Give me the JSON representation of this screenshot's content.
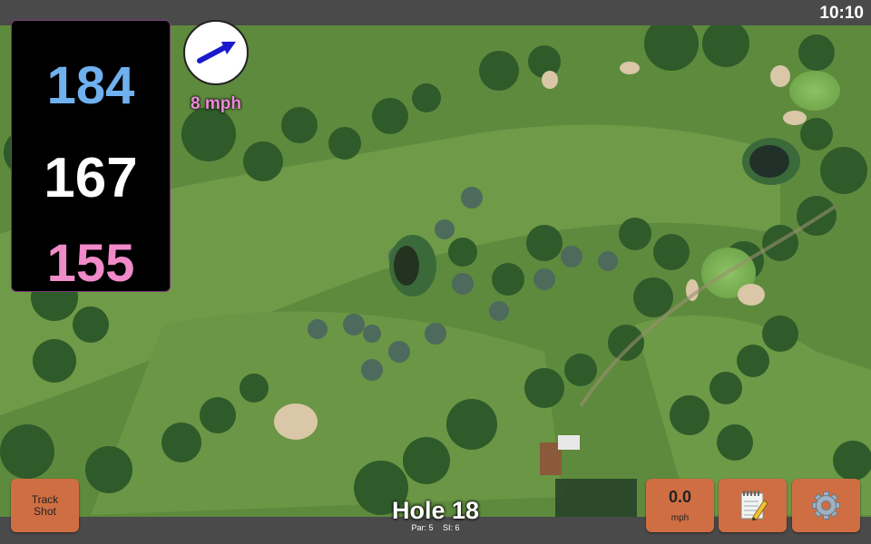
{
  "status": {
    "time": "10:10"
  },
  "distances": {
    "back": "184",
    "middle": "167",
    "front": "155"
  },
  "wind": {
    "speed_label": "8 mph",
    "direction_icon": "wind-arrow-icon"
  },
  "hole": {
    "title": "Hole 18",
    "par": "Par: 5",
    "si": "SI: 6"
  },
  "buttons": {
    "track_shot_line1": "Track",
    "track_shot_line2": "Shot",
    "speed_value": "0.0",
    "speed_unit": "mph",
    "notes_icon": "notepad-icon",
    "settings_icon": "gear-icon"
  },
  "colors": {
    "back_distance": "#6fb0ee",
    "middle_distance": "#ffffff",
    "front_distance": "#f08ac8",
    "wind_label": "#ee88dd",
    "button_bg": "#cf6e42",
    "panel_bg": "#000000"
  }
}
